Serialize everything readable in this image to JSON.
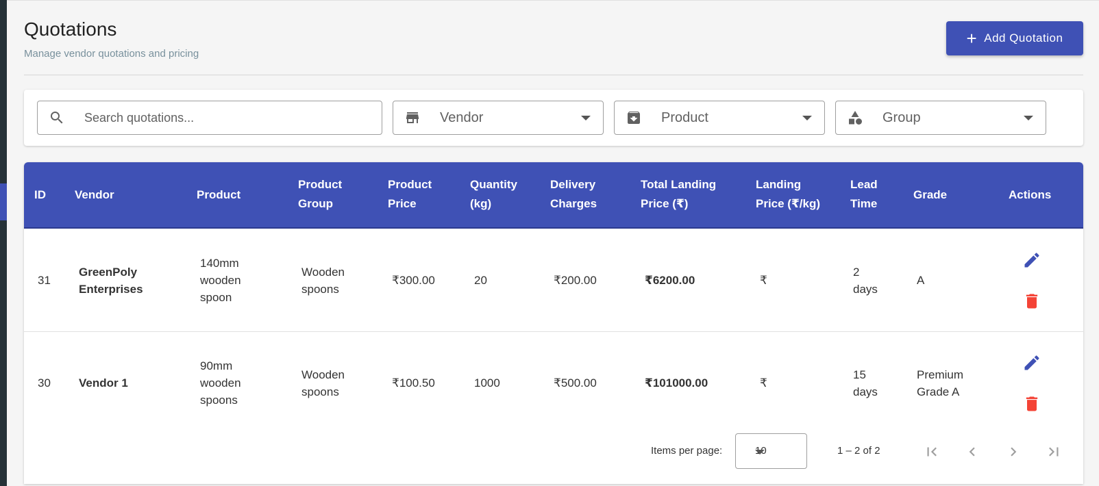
{
  "header": {
    "title": "Quotations",
    "subtitle": "Manage vendor quotations and pricing",
    "add_button_label": "Add Quotation"
  },
  "filters": {
    "search_placeholder": "Search quotations...",
    "vendor_label": "Vendor",
    "product_label": "Product",
    "group_label": "Group"
  },
  "table": {
    "columns": {
      "id": "ID",
      "vendor": "Vendor",
      "product": "Product",
      "product_group_1": "Product",
      "product_group_2": "Group",
      "product_price_1": "Product",
      "product_price_2": "Price",
      "quantity_1": "Quantity",
      "quantity_2": "(kg)",
      "delivery_1": "Delivery",
      "delivery_2": "Charges",
      "total_1": "Total Landing",
      "total_2": "Price (₹)",
      "landing_1": "Landing",
      "landing_2": "Price (₹/kg)",
      "lead_1": "Lead",
      "lead_2": "Time",
      "grade": "Grade",
      "actions": "Actions"
    },
    "rows": [
      {
        "id": "31",
        "vendor_1": "GreenPoly",
        "vendor_2": "Enterprises",
        "product_1": "140mm",
        "product_2": "wooden",
        "product_3": "spoon",
        "group_1": "Wooden",
        "group_2": "spoons",
        "price": "₹300.00",
        "quantity": "20",
        "delivery": "₹200.00",
        "total": "₹6200.00",
        "landing": "₹",
        "lead_1": "2",
        "lead_2": "days",
        "grade_1": "A",
        "grade_2": ""
      },
      {
        "id": "30",
        "vendor_1": "Vendor 1",
        "vendor_2": "",
        "product_1": "90mm",
        "product_2": "wooden",
        "product_3": "spoons",
        "group_1": "Wooden",
        "group_2": "spoons",
        "price": "₹100.50",
        "quantity": "1000",
        "delivery": "₹500.00",
        "total": "₹101000.00",
        "landing": "₹",
        "lead_1": "15",
        "lead_2": "days",
        "grade_1": "Premium",
        "grade_2": "Grade A"
      }
    ]
  },
  "paginator": {
    "items_per_page_label": "Items per page:",
    "page_size": "10",
    "range": "1 – 2 of 2"
  },
  "colors": {
    "primary": "#3f51b5",
    "danger": "#f44336"
  },
  "icons": [
    "add-icon",
    "search-icon",
    "store-icon",
    "archive-icon",
    "category-icon",
    "edit-icon",
    "delete-icon",
    "first-page-icon",
    "previous-page-icon",
    "next-page-icon",
    "last-page-icon"
  ]
}
